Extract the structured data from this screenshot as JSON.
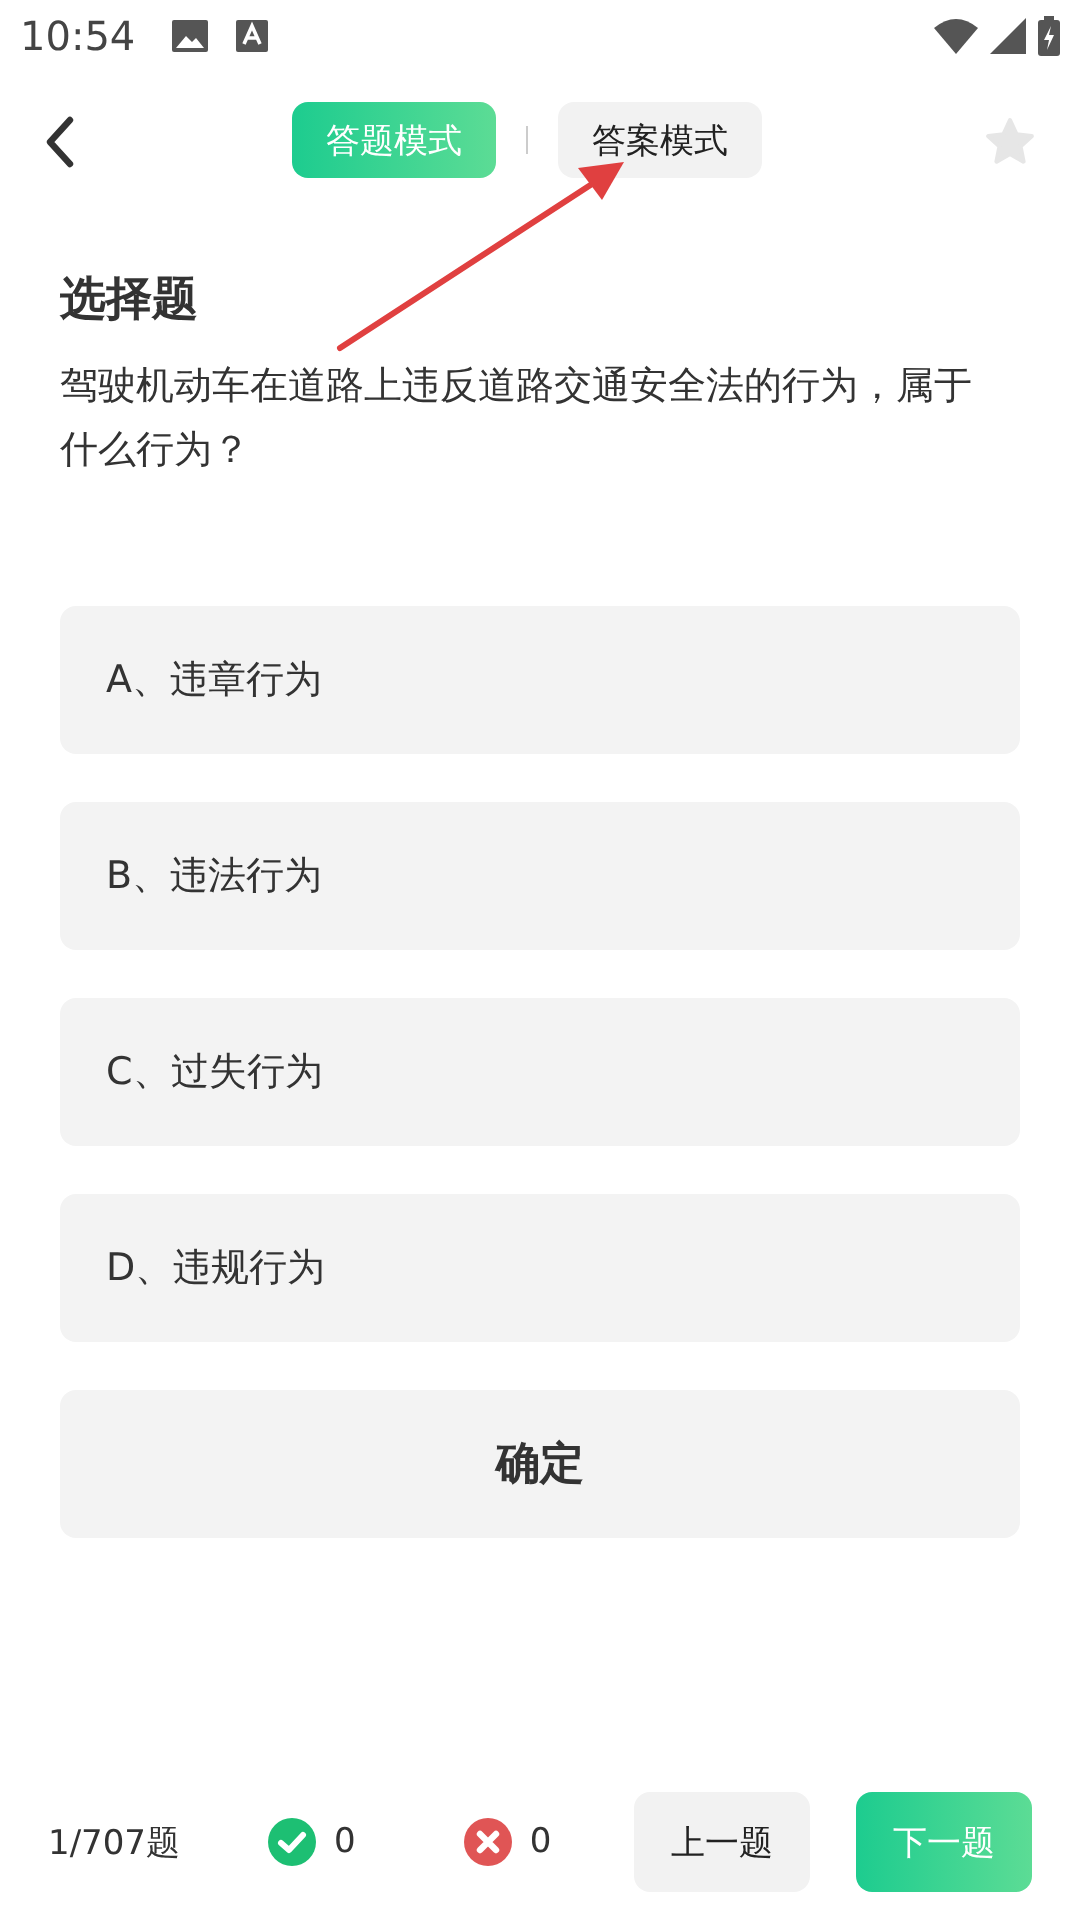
{
  "status_bar": {
    "time": "10:54"
  },
  "modes": [
    {
      "label": "答题模式",
      "selected": true
    },
    {
      "label": "答案模式",
      "selected": false
    }
  ],
  "favorite": {
    "starred": false
  },
  "question": {
    "type": "选择题",
    "text": "驾驶机动车在道路上违反道路交通安全法的行为，属于什么行为？"
  },
  "options": [
    {
      "label": "A、违章行为",
      "selected": false
    },
    {
      "label": "B、违法行为",
      "selected": false
    },
    {
      "label": "C、过失行为",
      "selected": false
    },
    {
      "label": "D、违规行为",
      "selected": false
    }
  ],
  "confirm_button": "确定",
  "footer": {
    "progress": "1/707题",
    "correct_count": "0",
    "wrong_count": "0",
    "prev_button": "上一题",
    "next_button": "下一题"
  }
}
